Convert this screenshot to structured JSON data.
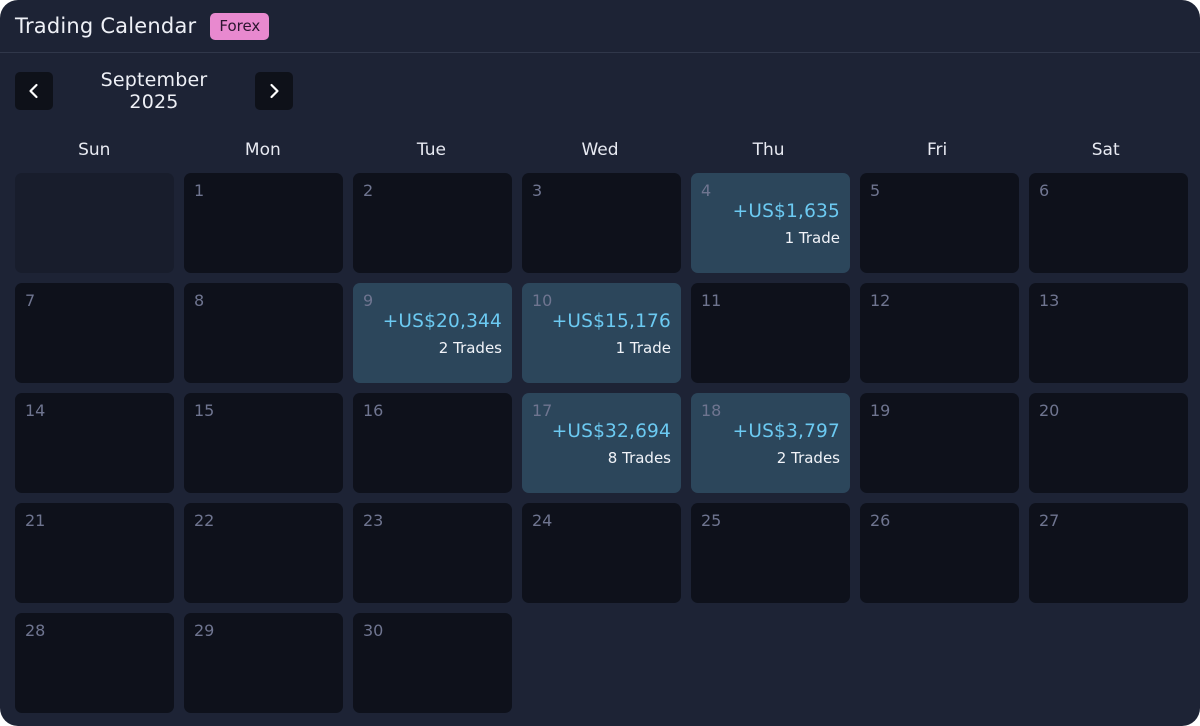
{
  "header": {
    "title": "Trading Calendar",
    "badge": "Forex"
  },
  "nav": {
    "month_label": "September 2025",
    "prev_icon": "chevron-left-icon",
    "next_icon": "chevron-right-icon"
  },
  "weekdays": [
    "Sun",
    "Mon",
    "Tue",
    "Wed",
    "Thu",
    "Fri",
    "Sat"
  ],
  "leading_blank_days": 1,
  "days": [
    {
      "day": "1"
    },
    {
      "day": "2"
    },
    {
      "day": "3"
    },
    {
      "day": "4",
      "pnl": "+US$1,635",
      "trades": "1 Trade"
    },
    {
      "day": "5"
    },
    {
      "day": "6"
    },
    {
      "day": "7"
    },
    {
      "day": "8"
    },
    {
      "day": "9",
      "pnl": "+US$20,344",
      "trades": "2 Trades"
    },
    {
      "day": "10",
      "pnl": "+US$15,176",
      "trades": "1 Trade"
    },
    {
      "day": "11"
    },
    {
      "day": "12"
    },
    {
      "day": "13"
    },
    {
      "day": "14"
    },
    {
      "day": "15"
    },
    {
      "day": "16"
    },
    {
      "day": "17",
      "pnl": "+US$32,694",
      "trades": "8 Trades"
    },
    {
      "day": "18",
      "pnl": "+US$3,797",
      "trades": "2 Trades"
    },
    {
      "day": "19"
    },
    {
      "day": "20"
    },
    {
      "day": "21"
    },
    {
      "day": "22"
    },
    {
      "day": "23"
    },
    {
      "day": "24"
    },
    {
      "day": "25"
    },
    {
      "day": "26"
    },
    {
      "day": "27"
    },
    {
      "day": "28"
    },
    {
      "day": "29"
    },
    {
      "day": "30"
    }
  ],
  "colors": {
    "background": "#1d2335",
    "day_cell": "#0e111b",
    "trade_cell": "#2c465b",
    "pnl_text": "#6ccaf2",
    "badge": "#e889cf"
  }
}
